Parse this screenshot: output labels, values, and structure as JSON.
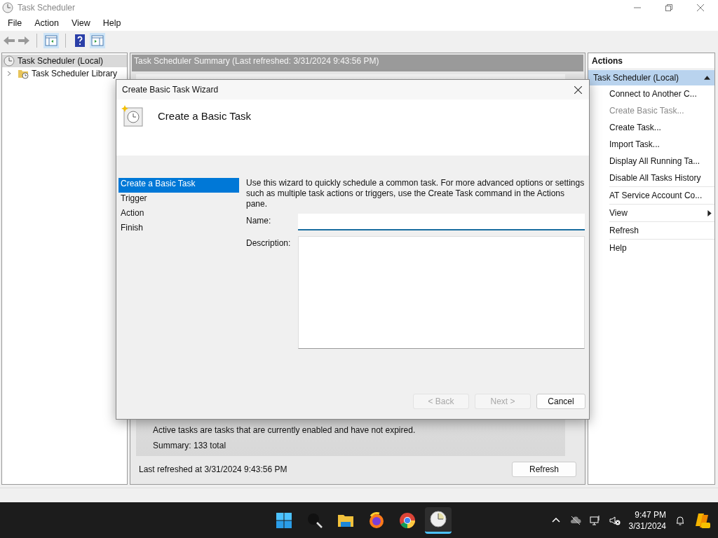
{
  "window": {
    "title": "Task Scheduler"
  },
  "menu": [
    "File",
    "Action",
    "View",
    "Help"
  ],
  "tree": [
    {
      "label": "Task Scheduler (Local)",
      "selected": true,
      "children": [
        {
          "label": "Task Scheduler Library",
          "selected": false,
          "expanded": false
        }
      ]
    }
  ],
  "summary": {
    "header": "Task Scheduler Summary (Last refreshed: 3/31/2024 9:43:56 PM)",
    "note": "Active tasks are tasks that are currently enabled and have not expired.",
    "total": "Summary: 133 total",
    "last_refreshed": "Last refreshed at 3/31/2024 9:43:56 PM",
    "refresh_button": "Refresh"
  },
  "actions": {
    "title": "Actions",
    "group": "Task Scheduler (Local)",
    "expanded": true,
    "items": [
      {
        "label": "Connect to Another C...",
        "kind": "item",
        "disabled": false,
        "divider": false
      },
      {
        "label": "Create Basic Task...",
        "kind": "item",
        "disabled": true,
        "divider": false
      },
      {
        "label": "Create Task...",
        "kind": "item",
        "disabled": false,
        "divider": false
      },
      {
        "label": "Import Task...",
        "kind": "item",
        "disabled": false,
        "divider": false
      },
      {
        "label": "Display All Running Ta...",
        "kind": "item",
        "disabled": false,
        "divider": false
      },
      {
        "label": "Disable All Tasks History",
        "kind": "item",
        "disabled": false,
        "divider": true
      },
      {
        "label": "AT Service Account Co...",
        "kind": "item",
        "disabled": false,
        "divider": true
      },
      {
        "label": "View",
        "kind": "submenu",
        "disabled": false,
        "divider": true
      },
      {
        "label": "Refresh",
        "kind": "item",
        "disabled": false,
        "divider": true
      },
      {
        "label": "Help",
        "kind": "item",
        "disabled": false,
        "divider": false
      }
    ]
  },
  "dialog": {
    "title": "Create Basic Task Wizard",
    "heading": "Create a Basic Task",
    "steps": [
      {
        "label": "Create a Basic Task",
        "selected": true
      },
      {
        "label": "Trigger",
        "selected": false
      },
      {
        "label": "Action",
        "selected": false
      },
      {
        "label": "Finish",
        "selected": false
      }
    ],
    "intro": "Use this wizard to quickly schedule a common task.  For more advanced options or settings such as multiple task actions or triggers, use the Create Task command in the Actions pane.",
    "name_label": "Name:",
    "description_label": "Description:",
    "buttons": [
      {
        "label": "< Back",
        "disabled": true
      },
      {
        "label": "Next >",
        "disabled": true
      },
      {
        "label": "Cancel",
        "disabled": false
      }
    ]
  },
  "taskbar": {
    "apps": [
      {
        "kind": "start",
        "selected": false
      },
      {
        "kind": "search",
        "selected": false
      },
      {
        "kind": "files",
        "selected": false
      },
      {
        "kind": "firefox",
        "selected": false
      },
      {
        "kind": "chrome",
        "selected": false
      },
      {
        "kind": "scheduler",
        "selected": true
      }
    ],
    "time": "9:47 PM",
    "date": "3/31/2024"
  }
}
